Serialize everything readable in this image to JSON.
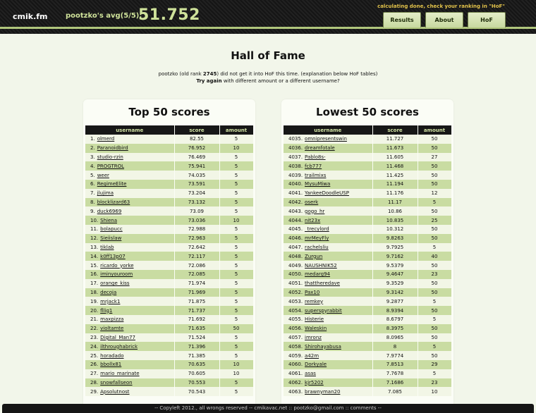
{
  "header": {
    "logo": "cmik.fm",
    "avg_label": "pootzko's avg(5/5):",
    "avg_value": "51.752",
    "notice": "calculating done, check your ranking in \"HoF\"",
    "nav": {
      "results": "Results",
      "about": "About",
      "hof": "HoF"
    }
  },
  "page": {
    "title": "Hall of Fame",
    "intro_user": "pootzko",
    "intro_pre_rank": " (old rank ",
    "intro_rank": "2745",
    "intro_post": ") did not get it into HoF this time. (explanation below HoF tables)",
    "intro2_bold": "Try again",
    "intro2_rest": " with different amount or a different username?"
  },
  "top": {
    "title": "Top 50 scores",
    "columns": [
      "username",
      "score",
      "amount"
    ],
    "rows": [
      {
        "rank": "1.",
        "user": "olmerd",
        "score": "82.55",
        "amount": "5"
      },
      {
        "rank": "2.",
        "user": "Paranoidbird",
        "score": "76.952",
        "amount": "10"
      },
      {
        "rank": "3.",
        "user": "studio-rzin",
        "score": "76.469",
        "amount": "5"
      },
      {
        "rank": "4.",
        "user": "PROGTROL",
        "score": "75.941",
        "amount": "5"
      },
      {
        "rank": "5.",
        "user": "weer",
        "score": "74.035",
        "amount": "5"
      },
      {
        "rank": "6.",
        "user": "RegimeElite",
        "score": "73.591",
        "amount": "5"
      },
      {
        "rank": "7.",
        "user": "jlujima",
        "score": "73.204",
        "amount": "5"
      },
      {
        "rank": "8.",
        "user": "blocklizard63",
        "score": "73.132",
        "amount": "5"
      },
      {
        "rank": "9.",
        "user": "duck6969",
        "score": "73.09",
        "amount": "5"
      },
      {
        "rank": "10.",
        "user": "Shiena",
        "score": "73.036",
        "amount": "10"
      },
      {
        "rank": "11.",
        "user": "bolapucc",
        "score": "72.988",
        "amount": "5"
      },
      {
        "rank": "12.",
        "user": "Sieiislaw",
        "score": "72.963",
        "amount": "5"
      },
      {
        "rank": "13.",
        "user": "tiklab",
        "score": "72.642",
        "amount": "5"
      },
      {
        "rank": "14.",
        "user": "k0ff13p07",
        "score": "72.117",
        "amount": "5"
      },
      {
        "rank": "15.",
        "user": "ricardo_yorke",
        "score": "72.086",
        "amount": "5"
      },
      {
        "rank": "16.",
        "user": "iminyouroom",
        "score": "72.085",
        "amount": "5"
      },
      {
        "rank": "17.",
        "user": "orange_kiss",
        "score": "71.974",
        "amount": "5"
      },
      {
        "rank": "18.",
        "user": "decoja",
        "score": "71.969",
        "amount": "5"
      },
      {
        "rank": "19.",
        "user": "mrjack1",
        "score": "71.875",
        "amount": "5"
      },
      {
        "rank": "20.",
        "user": "fllig1",
        "score": "71.737",
        "amount": "5"
      },
      {
        "rank": "21.",
        "user": "maxpizza",
        "score": "71.692",
        "amount": "5"
      },
      {
        "rank": "22.",
        "user": "violtamte",
        "score": "71.635",
        "amount": "50"
      },
      {
        "rank": "23.",
        "user": "Digital_Man77",
        "score": "71.524",
        "amount": "5"
      },
      {
        "rank": "24.",
        "user": "ilthroughabrick",
        "score": "71.396",
        "amount": "5"
      },
      {
        "rank": "25.",
        "user": "horadado",
        "score": "71.385",
        "amount": "5"
      },
      {
        "rank": "26.",
        "user": "bbollx81",
        "score": "70.635",
        "amount": "10"
      },
      {
        "rank": "27.",
        "user": "mario_marinate",
        "score": "70.605",
        "amount": "10"
      },
      {
        "rank": "28.",
        "user": "snowfallseon",
        "score": "70.553",
        "amount": "5"
      },
      {
        "rank": "29.",
        "user": "Apsolutnost",
        "score": "70.543",
        "amount": "5"
      }
    ]
  },
  "bottom": {
    "title": "Lowest 50 scores",
    "columns": [
      "username",
      "score",
      "amount"
    ],
    "rows": [
      {
        "rank": "4035.",
        "user": "omnipresentswin",
        "score": "11.727",
        "amount": "50"
      },
      {
        "rank": "4036.",
        "user": "dreamfotale",
        "score": "11.673",
        "amount": "50"
      },
      {
        "rank": "4037.",
        "user": "Pablo8s-",
        "score": "11.605",
        "amount": "27"
      },
      {
        "rank": "4038.",
        "user": "fcb777",
        "score": "11.468",
        "amount": "50"
      },
      {
        "rank": "4039.",
        "user": "trailmixs",
        "score": "11.425",
        "amount": "50"
      },
      {
        "rank": "4040.",
        "user": "MysuMiwa",
        "score": "11.194",
        "amount": "50"
      },
      {
        "rank": "4041.",
        "user": "YankeeDoodleUSP",
        "score": "11.176",
        "amount": "12"
      },
      {
        "rank": "4042.",
        "user": "oserk",
        "score": "11.17",
        "amount": "5"
      },
      {
        "rank": "4043.",
        "user": "gogo_hr",
        "score": "10.86",
        "amount": "50"
      },
      {
        "rank": "4044.",
        "user": "nit23x",
        "score": "10.835",
        "amount": "25"
      },
      {
        "rank": "4045.",
        "user": "_trecylord",
        "score": "10.312",
        "amount": "50"
      },
      {
        "rank": "4046.",
        "user": "mrMeyFly",
        "score": "9.8263",
        "amount": "50"
      },
      {
        "rank": "4047.",
        "user": "rachelsliu",
        "score": "9.7925",
        "amount": "5"
      },
      {
        "rank": "4048.",
        "user": "Zurgun",
        "score": "9.7162",
        "amount": "40"
      },
      {
        "rank": "4049.",
        "user": "NAUSHNIK52",
        "score": "9.5379",
        "amount": "50"
      },
      {
        "rank": "4050.",
        "user": "medarg94",
        "score": "9.4647",
        "amount": "23"
      },
      {
        "rank": "4051.",
        "user": "thattheredave",
        "score": "9.3529",
        "amount": "50"
      },
      {
        "rank": "4052.",
        "user": "Pax10",
        "score": "9.3142",
        "amount": "50"
      },
      {
        "rank": "4053.",
        "user": "remkey",
        "score": "9.2877",
        "amount": "5"
      },
      {
        "rank": "4054.",
        "user": "superspyrabbit",
        "score": "8.9394",
        "amount": "50"
      },
      {
        "rank": "4055.",
        "user": "Histerie",
        "score": "8.6797",
        "amount": "5"
      },
      {
        "rank": "4056.",
        "user": "Waleskin",
        "score": "8.3975",
        "amount": "50"
      },
      {
        "rank": "4057.",
        "user": "imronz",
        "score": "8.0965",
        "amount": "50"
      },
      {
        "rank": "4058.",
        "user": "Shirohayabusa",
        "score": "8",
        "amount": "5"
      },
      {
        "rank": "4059.",
        "user": "a42m",
        "score": "7.9774",
        "amount": "50"
      },
      {
        "rank": "4060.",
        "user": "Dorkyale",
        "score": "7.8513",
        "amount": "29"
      },
      {
        "rank": "4061.",
        "user": "asas",
        "score": "7.7678",
        "amount": "5"
      },
      {
        "rank": "4062.",
        "user": "kjr5202",
        "score": "7.1686",
        "amount": "23"
      },
      {
        "rank": "4063.",
        "user": "brawnyman20",
        "score": "7.085",
        "amount": "10"
      }
    ]
  },
  "footer": {
    "text": "-- Copyleft 2012., all wrongs reserved -- cmikavac.net :: pootzko@gmail.com :: comments --"
  }
}
